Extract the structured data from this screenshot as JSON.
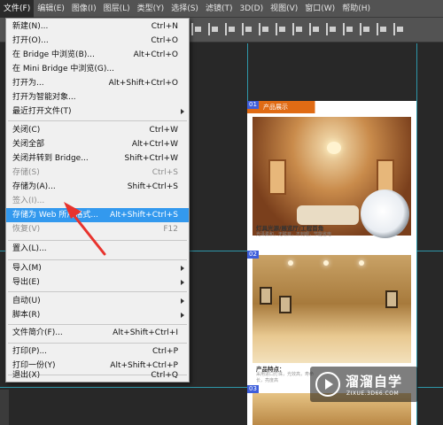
{
  "menubar": {
    "items": [
      "文件(F)",
      "编辑(E)",
      "图像(I)",
      "图层(L)",
      "类型(Y)",
      "选择(S)",
      "滤镜(T)",
      "3D(D)",
      "视图(V)",
      "窗口(W)",
      "帮助(H)"
    ]
  },
  "file_menu": {
    "items": [
      {
        "label": "新建(N)...",
        "shortcut": "Ctrl+N"
      },
      {
        "label": "打开(O)...",
        "shortcut": "Ctrl+O"
      },
      {
        "label": "在 Bridge 中浏览(B)...",
        "shortcut": "Alt+Ctrl+O"
      },
      {
        "label": "在 Mini Bridge 中浏览(G)...",
        "shortcut": ""
      },
      {
        "label": "打开为...",
        "shortcut": "Alt+Shift+Ctrl+O"
      },
      {
        "label": "打开为智能对象...",
        "shortcut": ""
      },
      {
        "label": "最近打开文件(T)",
        "shortcut": ""
      },
      {
        "label": "关闭(C)",
        "shortcut": "Ctrl+W"
      },
      {
        "label": "关闭全部",
        "shortcut": "Alt+Ctrl+W"
      },
      {
        "label": "关闭并转到 Bridge...",
        "shortcut": "Shift+Ctrl+W"
      },
      {
        "label": "存储(S)",
        "shortcut": "Ctrl+S"
      },
      {
        "label": "存储为(A)...",
        "shortcut": "Shift+Ctrl+S"
      },
      {
        "label": "签入(I)...",
        "shortcut": ""
      },
      {
        "label": "存储为 Web 所用格式...",
        "shortcut": "Alt+Shift+Ctrl+S"
      },
      {
        "label": "恢复(V)",
        "shortcut": "F12"
      },
      {
        "label": "置入(L)...",
        "shortcut": ""
      },
      {
        "label": "导入(M)",
        "shortcut": ""
      },
      {
        "label": "导出(E)",
        "shortcut": ""
      },
      {
        "label": "自动(U)",
        "shortcut": ""
      },
      {
        "label": "脚本(R)",
        "shortcut": ""
      },
      {
        "label": "文件简介(F)...",
        "shortcut": "Alt+Shift+Ctrl+I"
      },
      {
        "label": "打印(P)...",
        "shortcut": "Ctrl+P"
      },
      {
        "label": "打印一份(Y)",
        "shortcut": "Alt+Shift+Ctrl+P"
      },
      {
        "label": "退出(X)",
        "shortcut": "Ctrl+Q"
      }
    ]
  },
  "canvas": {
    "slice_tags": [
      "01",
      "02",
      "03"
    ],
    "band_text": "产品展示",
    "caption1": "灯具光源/展览厅/工程首角",
    "caption1_sub": "光泽柔和，无眩目，不刺眼，节能省电",
    "caption2": "产品特点：",
    "caption2_sub": "采用进口灯珠，光效高，寿命长，亮度高"
  },
  "watermark": {
    "title": "溜溜自学",
    "url": "ZIXUE.3D66.COM"
  },
  "colors": {
    "highlight": "#3399ee",
    "annotation": "#e8332d",
    "guide": "#2fb3c9",
    "slice_tag": "#3e5edb"
  }
}
